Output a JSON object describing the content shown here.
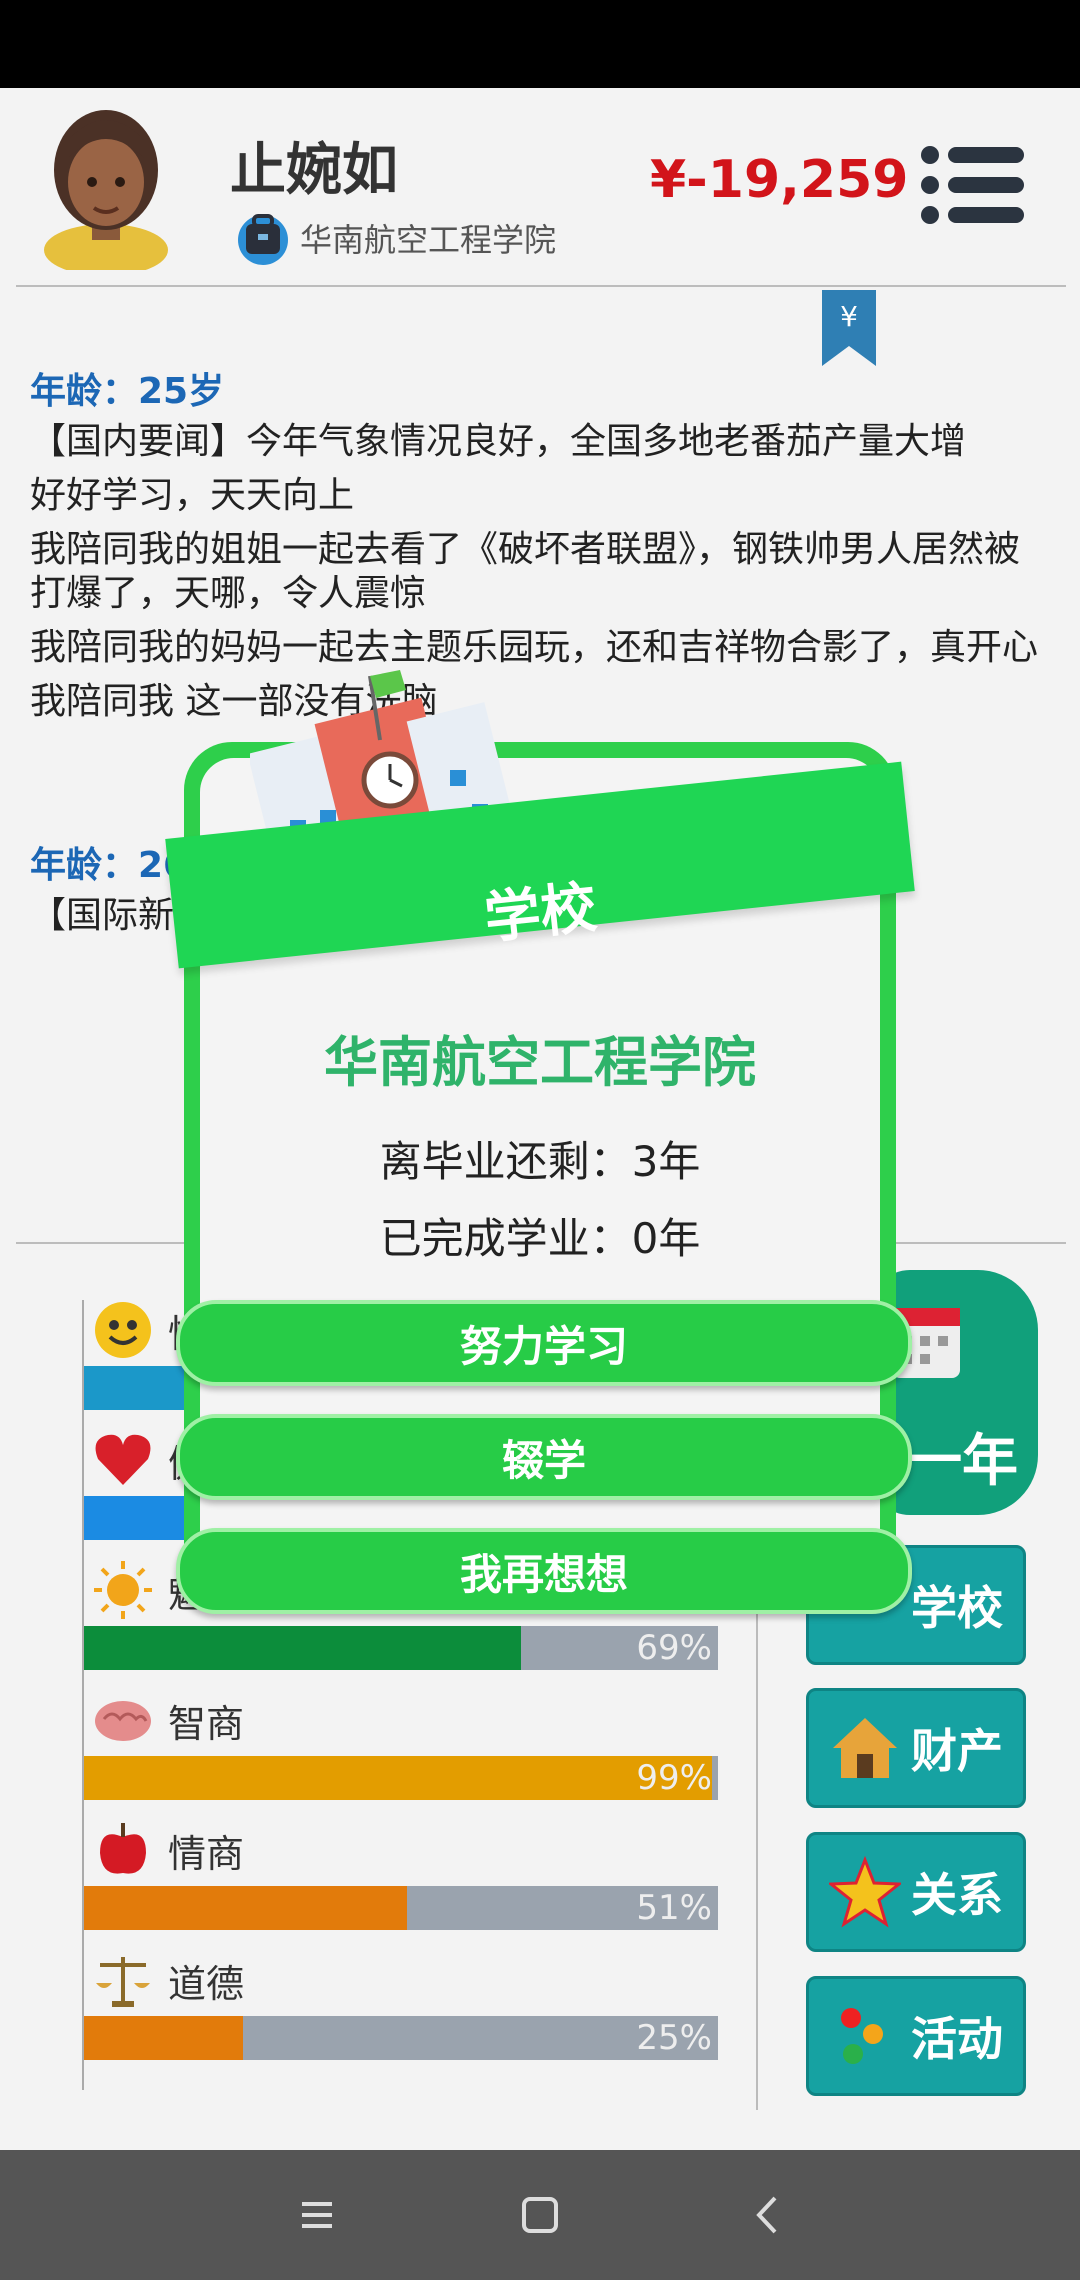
{
  "header": {
    "name": "止婉如",
    "school": "华南航空工程学院",
    "money": "¥-19,259"
  },
  "bookmark_symbol": "¥",
  "feed": [
    {
      "age": "年龄：25岁"
    },
    {
      "news": "【国内要闻】今年气象情况良好，全国多地老番茄产量大增"
    },
    {
      "news": "好好学习，天天向上"
    },
    {
      "news": "我陪同我的姐姐一起去看了《破坏者联盟》，钢铁帅男人居然被打爆了，天哪，令人震惊"
    },
    {
      "news": "我陪同我的妈妈一起去主题乐园玩，还和吉祥物合影了，真开心"
    },
    {
      "news": "我陪同我                                                      这一部没有洗脑"
    },
    {
      "age": "年龄：26"
    },
    {
      "news": "【国际新                                                      制降落伞试跳坠楼                                                      其坠亡全过程"
    }
  ],
  "stats": [
    {
      "label": "快乐",
      "pct_text": "",
      "fill": 0.35,
      "color": "#1b98c9",
      "icon": "smile-icon"
    },
    {
      "label": "健康",
      "pct_text": "",
      "fill": 0.35,
      "color": "#1b8be3",
      "icon": "heart-icon"
    },
    {
      "label": "魅力",
      "pct_text": "69%",
      "fill": 0.69,
      "color": "#0c8d3b",
      "icon": "sun-icon"
    },
    {
      "label": "智商",
      "pct_text": "99%",
      "fill": 0.99,
      "color": "#e39d00",
      "icon": "brain-icon"
    },
    {
      "label": "情商",
      "pct_text": "51%",
      "fill": 0.51,
      "color": "#e27b0b",
      "icon": "apple-icon"
    },
    {
      "label": "道德",
      "pct_text": "25%",
      "fill": 0.25,
      "color": "#e27b0b",
      "icon": "scale-icon"
    }
  ],
  "side": {
    "next_year": "一年",
    "school": "学校",
    "property": "财产",
    "relation": "关系",
    "activity": "活动"
  },
  "modal": {
    "title": "学校",
    "school_name": "华南航空工程学院",
    "remaining": "离毕业还剩：3年",
    "completed": "已完成学业：0年",
    "btn_study": "努力学习",
    "btn_drop": "辍学",
    "btn_think": "我再想想"
  },
  "colors": {
    "accent_green": "#27cc47",
    "money_red": "#d2141a",
    "age_blue": "#1c67b5",
    "teal": "#16a2a2"
  }
}
